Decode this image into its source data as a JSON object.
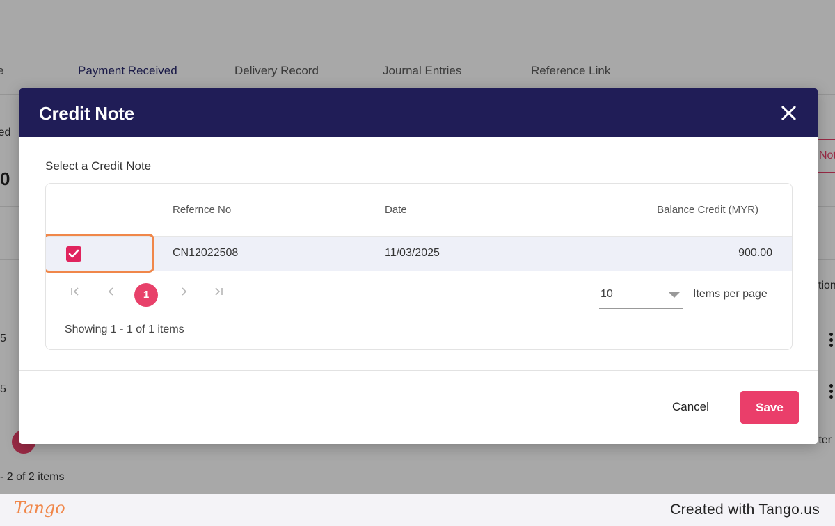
{
  "background": {
    "tab_partial": "e",
    "tabs": [
      "Payment Received",
      "Delivery Record",
      "Journal Entries",
      "Reference Link"
    ],
    "partial_label": "ied",
    "partial_big": "0",
    "partial_btn": "Not",
    "partial_action": "tion",
    "partial_row1": "5",
    "partial_row2": "5",
    "partial_items_right": "Iter",
    "partial_showing": "- 2 of 2 items"
  },
  "modal": {
    "title": "Credit Note",
    "subtitle": "Select a Credit Note",
    "columns": {
      "ref": "Refernce No",
      "date": "Date",
      "balance": "Balance Credit (MYR)"
    },
    "rows": [
      {
        "ref": "CN12022508",
        "date": "11/03/2025",
        "balance": "900.00",
        "checked": true
      }
    ],
    "pager": {
      "current_page": "1",
      "per_page": "10",
      "per_page_label": "Items per page",
      "showing": "Showing 1 - 1 of 1 items"
    },
    "cancel_label": "Cancel",
    "save_label": "Save"
  },
  "tango": {
    "logo": "Tango",
    "credit": "Created with Tango.us"
  },
  "colors": {
    "header": "#201d57",
    "accent": "#e8416a",
    "highlight": "#f0874a"
  }
}
